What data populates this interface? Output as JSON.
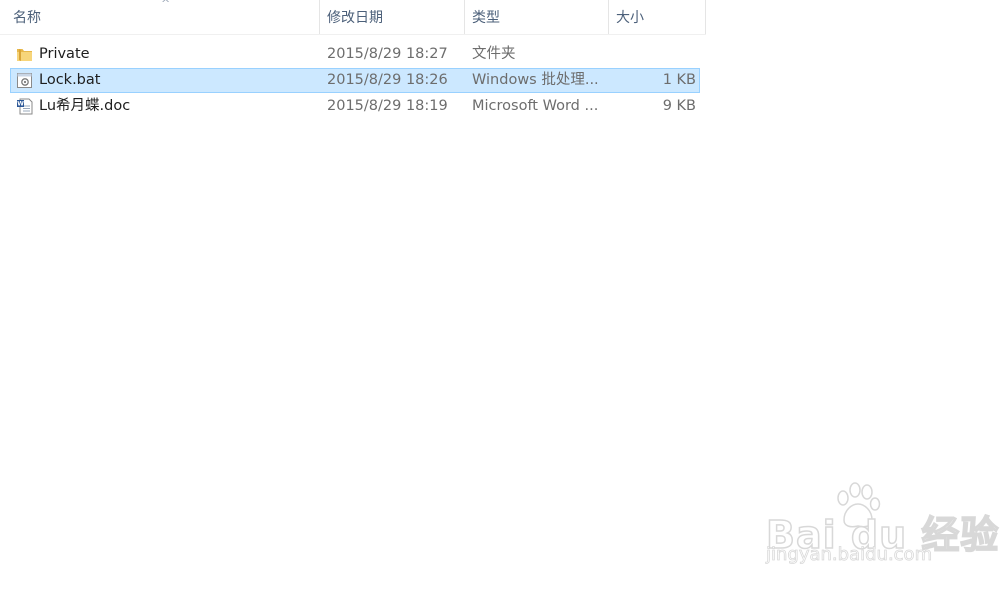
{
  "columns": {
    "name": "名称",
    "date": "修改日期",
    "type": "类型",
    "size": "大小"
  },
  "sort": {
    "column": "name",
    "icon": "sort-up-caret-icon"
  },
  "files": [
    {
      "name": "Private",
      "date": "2015/8/29 18:27",
      "type": "文件夹",
      "size": "",
      "icon": "folder-icon",
      "selected": false
    },
    {
      "name": "Lock.bat",
      "date": "2015/8/29 18:26",
      "type": "Windows 批处理...",
      "size": "1 KB",
      "icon": "batch-file-icon",
      "selected": true
    },
    {
      "name": "Lu希月蝶.doc",
      "date": "2015/8/29 18:19",
      "type": "Microsoft Word ...",
      "size": "9 KB",
      "icon": "word-document-icon",
      "selected": false
    }
  ],
  "watermark": {
    "logo_text": "Bai du 经验",
    "url": "jingyan.baidu.com"
  },
  "colors": {
    "selection_fill": "#cce8ff",
    "selection_border": "#99d1ff",
    "header_text": "#4c607a",
    "secondary_text": "#6d6d6d"
  }
}
